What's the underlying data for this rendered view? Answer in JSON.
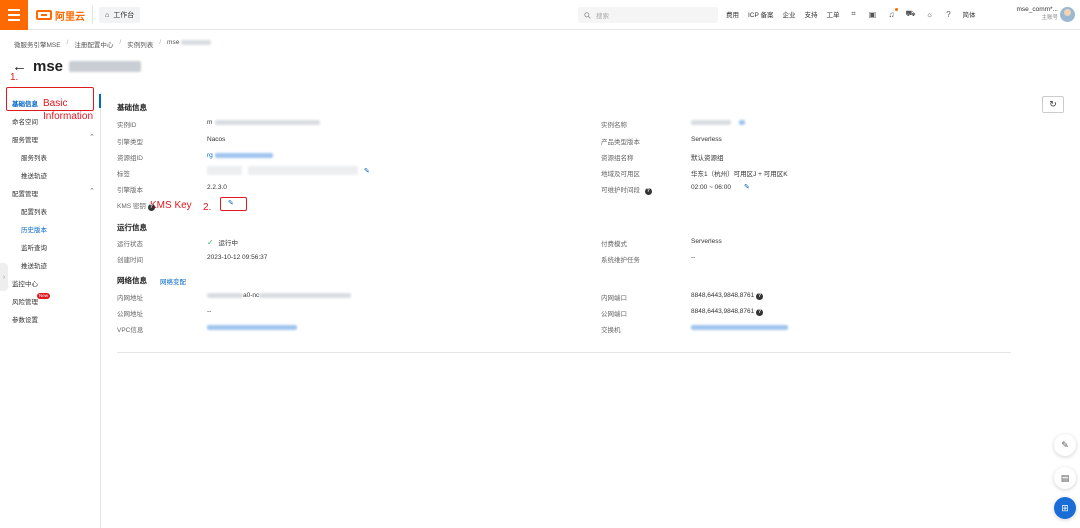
{
  "topbar": {
    "logo_text": "阿里云",
    "workbench": "工作台",
    "search_placeholder": "搜索",
    "links": [
      "费用",
      "ICP 备案",
      "企业",
      "支持",
      "工单"
    ],
    "lang": "简体",
    "user_name": "mse_comm*...",
    "user_role": "主账号"
  },
  "breadcrumb": [
    "微服务引擎MSE",
    "注册配置中心",
    "实例列表",
    "mse"
  ],
  "page_title": "mse",
  "annotations": {
    "step1": "1.",
    "basic_line1": "Basic",
    "basic_line2": "Information",
    "step2": "2.",
    "kms_key": "KMS Key"
  },
  "sidebar": {
    "basic_info": "基础信息",
    "namespace": "命名空间",
    "service_mgmt": "服务管理",
    "service_list": "服务列表",
    "push_trace_1": "推送轨迹",
    "config_mgmt": "配置管理",
    "config_list": "配置列表",
    "history_version": "历史版本",
    "listener_query": "监听查询",
    "push_trace_2": "推送轨迹",
    "monitor_center": "监控中心",
    "risk_mgmt": "风险管理",
    "new_badge": "New",
    "param_settings": "参数设置"
  },
  "basic": {
    "section_title": "基础信息",
    "instance_id_label": "实例ID",
    "instance_id_value": "m",
    "engine_type_label": "引擎类型",
    "engine_type_value": "Nacos",
    "resource_group_id_label": "资源组ID",
    "resource_group_id_value": "rg",
    "tags_label": "标签",
    "engine_version_label": "引擎版本",
    "engine_version_value": "2.2.3.0",
    "kms_label": "KMS 密钥",
    "instance_name_label": "实例名称",
    "product_version_label": "产品类型版本",
    "product_version_value": "Serverless",
    "resource_group_name_label": "资源组名称",
    "resource_group_name_value": "默认资源组",
    "region_label": "地域及可用区",
    "region_value": "华东1（杭州）可用区J + 可用区K",
    "maintenance_window_label": "可维护时间段",
    "maintenance_window_value": "02:00 ~ 06:00"
  },
  "running": {
    "section_title": "运行信息",
    "status_label": "运行状态",
    "status_value": "运行中",
    "created_label": "创建时间",
    "created_value": "2023-10-12 09:56:37",
    "billing_label": "付费模式",
    "billing_value": "Serverless",
    "system_task_label": "系统维护任务",
    "system_task_value": "--"
  },
  "network": {
    "section_title": "网络信息",
    "network_change_link": "网络变配",
    "intranet_addr_label": "内网地址",
    "intranet_addr_value": "a0-nc",
    "public_addr_label": "公网地址",
    "public_addr_value": "--",
    "vpc_label": "VPC信息",
    "intranet_port_label": "内网端口",
    "intranet_port_value": "8848,6443,9848,8761",
    "public_port_label": "公网端口",
    "public_port_value": "8848,6443,9848,8761",
    "switch_label": "交换机"
  },
  "colors": {
    "brand": "#ff6a00",
    "link": "#0064c8",
    "annotation": "#e0191f",
    "success": "#2db36f"
  },
  "icons": [
    "hamburger-icon",
    "home-icon",
    "search-icon",
    "bell-icon",
    "cart-icon",
    "help-icon",
    "refresh-icon",
    "edit-icon",
    "check-icon",
    "back-arrow-icon"
  ]
}
